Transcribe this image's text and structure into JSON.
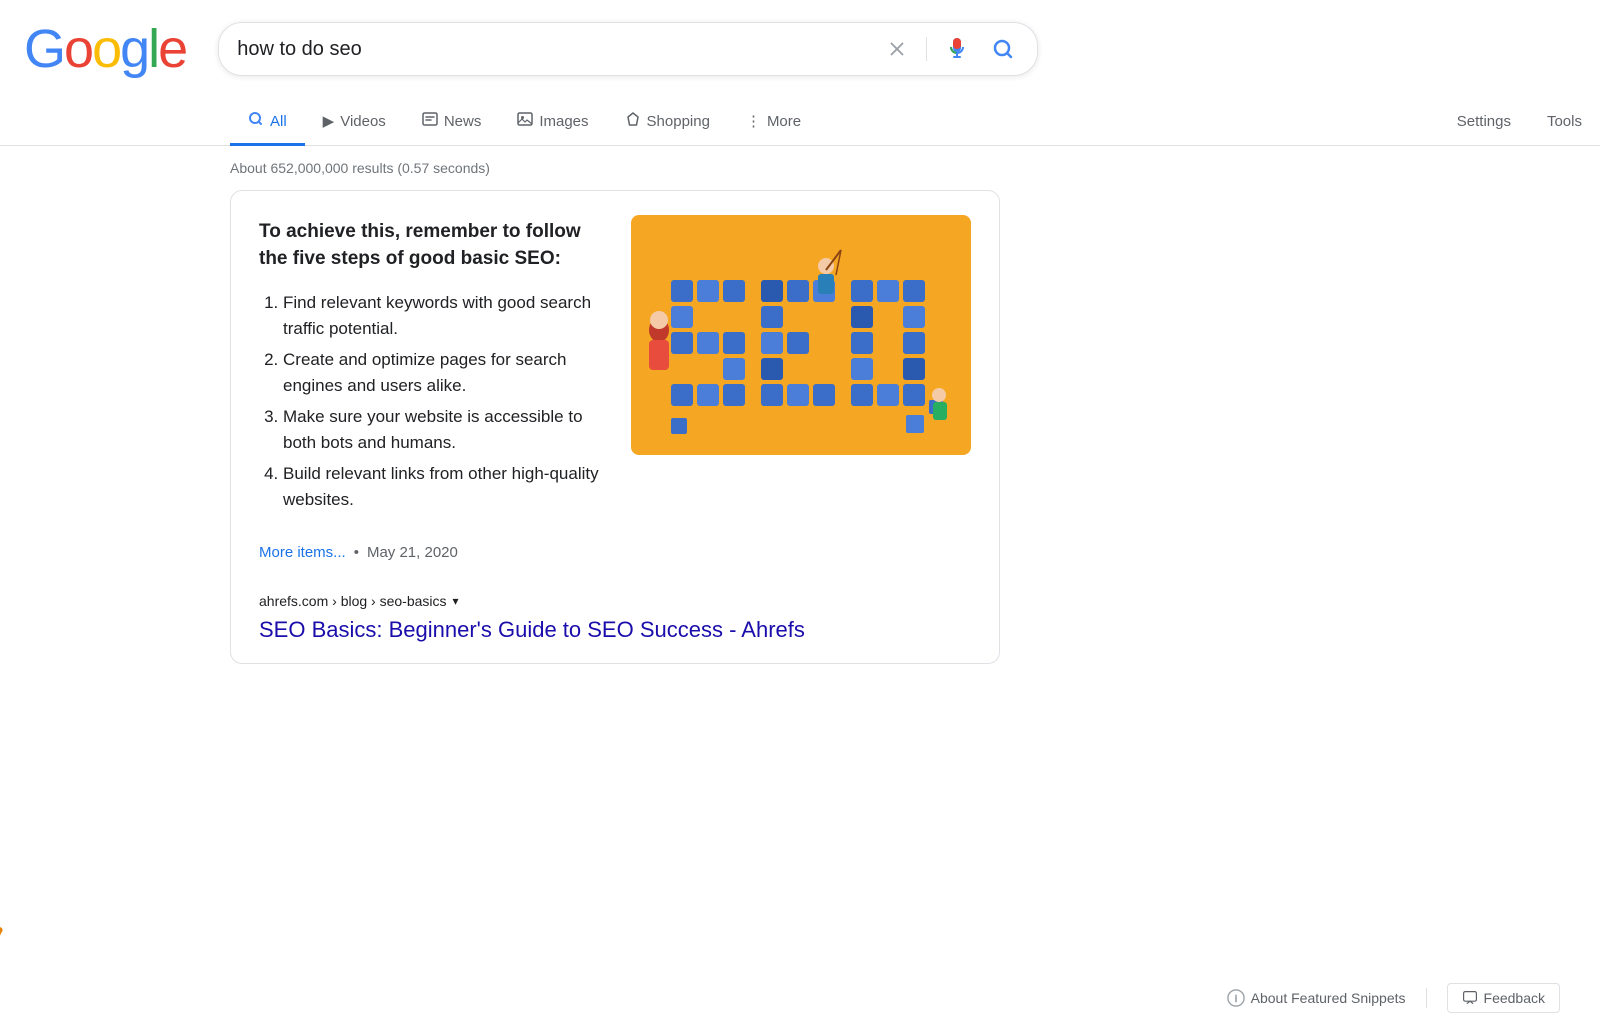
{
  "header": {
    "logo": "Google",
    "logo_letters": [
      "G",
      "o",
      "o",
      "g",
      "l",
      "e"
    ],
    "search_query": "how to do seo",
    "clear_button_title": "Clear",
    "voice_search_title": "Search by voice",
    "search_button_title": "Search"
  },
  "nav": {
    "tabs": [
      {
        "id": "all",
        "label": "All",
        "icon": "🔍",
        "active": true
      },
      {
        "id": "videos",
        "label": "Videos",
        "icon": "▶",
        "active": false
      },
      {
        "id": "news",
        "label": "News",
        "icon": "📰",
        "active": false
      },
      {
        "id": "images",
        "label": "Images",
        "icon": "🖼",
        "active": false
      },
      {
        "id": "shopping",
        "label": "Shopping",
        "icon": "◇",
        "active": false
      },
      {
        "id": "more",
        "label": "More",
        "icon": "⋮",
        "active": false
      }
    ],
    "settings_label": "Settings",
    "tools_label": "Tools"
  },
  "results": {
    "count_text": "About 652,000,000 results (0.57 seconds)"
  },
  "featured_snippet": {
    "title": "To achieve this, remember to follow the five steps of good basic SEO:",
    "list_items": [
      "Find relevant keywords with good search traffic potential.",
      "Create and optimize pages for search engines and users alike.",
      "Make sure your website is accessible to both bots and humans.",
      "Build relevant links from other high-quality websites."
    ],
    "more_items_label": "More items...",
    "date": "May 21, 2020",
    "source_breadcrumb": "ahrefs.com › blog › seo-basics",
    "result_title": "SEO Basics: Beginner's Guide to SEO Success - Ahrefs"
  },
  "bottom": {
    "about_snippets_label": "About Featured Snippets",
    "feedback_label": "Feedback"
  }
}
